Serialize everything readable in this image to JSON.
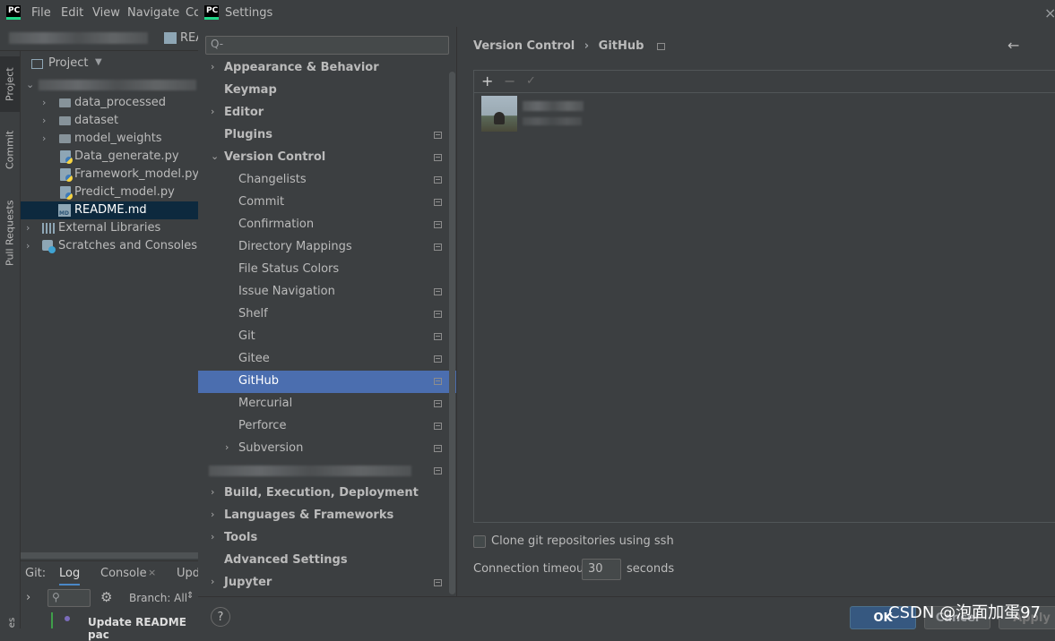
{
  "ide": {
    "logo": "PC",
    "menu": [
      "File",
      "Edit",
      "View",
      "Navigate",
      "Co"
    ],
    "breadcrumb_tail": "REA",
    "side_tabs": [
      "Project",
      "Commit",
      "Pull Requests"
    ],
    "project": {
      "title": "Project",
      "tree": [
        {
          "label": "data_processed",
          "type": "folder"
        },
        {
          "label": "dataset",
          "type": "folder"
        },
        {
          "label": "model_weights",
          "type": "folder"
        },
        {
          "label": "Data_generate.py",
          "type": "python"
        },
        {
          "label": "Framework_model.py",
          "type": "python"
        },
        {
          "label": "Predict_model.py",
          "type": "python"
        },
        {
          "label": "README.md",
          "type": "markdown",
          "selected": true
        },
        {
          "label": "External Libraries",
          "type": "library"
        },
        {
          "label": "Scratches and Consoles",
          "type": "scratch"
        }
      ],
      "md_badge": "MD"
    },
    "bottom": {
      "tabs": [
        "Git:",
        "Log",
        "Console",
        "Upd"
      ],
      "branch": "Branch: All",
      "commit": "Update README pac",
      "side_text": "es"
    }
  },
  "settings": {
    "title": "Settings",
    "search_placeholder": "Q-",
    "nav": [
      {
        "label": "Appearance & Behavior",
        "level": 0,
        "arrow": "›",
        "bold": true
      },
      {
        "label": "Keymap",
        "level": 0,
        "bold": true
      },
      {
        "label": "Editor",
        "level": 0,
        "arrow": "›",
        "bold": true
      },
      {
        "label": "Plugins",
        "level": 0,
        "bold": true,
        "proj": true
      },
      {
        "label": "Version Control",
        "level": 0,
        "arrow": "⌄",
        "bold": true,
        "proj": true
      },
      {
        "label": "Changelists",
        "level": 1,
        "proj": true
      },
      {
        "label": "Commit",
        "level": 1,
        "proj": true
      },
      {
        "label": "Confirmation",
        "level": 1,
        "proj": true
      },
      {
        "label": "Directory Mappings",
        "level": 1,
        "proj": true
      },
      {
        "label": "File Status Colors",
        "level": 1
      },
      {
        "label": "Issue Navigation",
        "level": 1,
        "proj": true
      },
      {
        "label": "Shelf",
        "level": 1,
        "proj": true
      },
      {
        "label": "Git",
        "level": 1,
        "proj": true
      },
      {
        "label": "Gitee",
        "level": 1,
        "proj": true
      },
      {
        "label": "GitHub",
        "level": 1,
        "proj": true,
        "selected": true
      },
      {
        "label": "Mercurial",
        "level": 1,
        "proj": true
      },
      {
        "label": "Perforce",
        "level": 1,
        "proj": true
      },
      {
        "label": "Subversion",
        "level": 1,
        "arrow": "›",
        "proj": true
      },
      {
        "label": "",
        "level": 1,
        "proj": true,
        "blurred": true
      },
      {
        "label": "Build, Execution, Deployment",
        "level": 0,
        "arrow": "›",
        "bold": true
      },
      {
        "label": "Languages & Frameworks",
        "level": 0,
        "arrow": "›",
        "bold": true
      },
      {
        "label": "Tools",
        "level": 0,
        "arrow": "›",
        "bold": true
      },
      {
        "label": "Advanced Settings",
        "level": 0,
        "bold": true
      },
      {
        "label": "Jupyter",
        "level": 0,
        "arrow": "›",
        "bold": true,
        "proj": true
      }
    ],
    "breadcrumb": {
      "parent": "Version Control",
      "sep": "›",
      "current": "GitHub"
    },
    "toolbar": {
      "add": "+",
      "remove": "−",
      "check": "✓"
    },
    "clone_ssh_label": "Clone git repositories using ssh",
    "clone_ssh_checked": false,
    "timeout_label": "Connection timeout:",
    "timeout_value": "30",
    "timeout_unit": "seconds",
    "help": "?",
    "buttons": {
      "ok": "OK",
      "cancel": "Cancel",
      "apply": "Apply"
    },
    "back_arrow": "←",
    "close": "×"
  },
  "watermark": "CSDN @泡面加蛋97"
}
